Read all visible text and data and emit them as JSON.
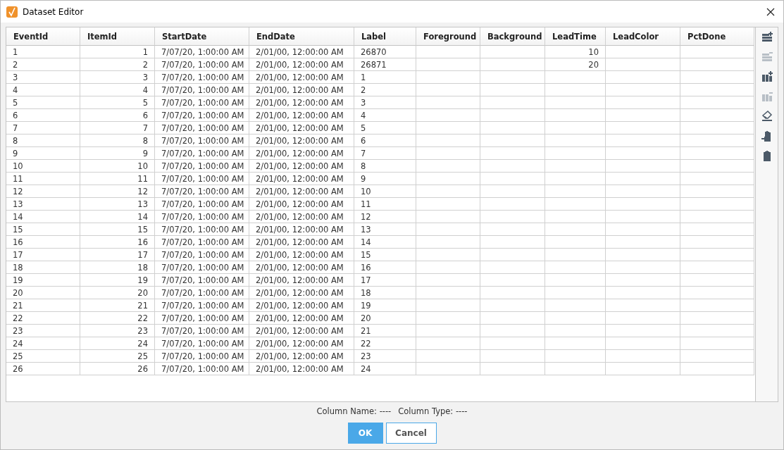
{
  "window": {
    "title": "Dataset Editor"
  },
  "table": {
    "columns": [
      {
        "label": "EventId",
        "numeric": false
      },
      {
        "label": "ItemId",
        "numeric": true
      },
      {
        "label": "StartDate",
        "numeric": false
      },
      {
        "label": "EndDate",
        "numeric": false
      },
      {
        "label": "Label",
        "numeric": false
      },
      {
        "label": "Foreground"
      },
      {
        "label": "Background"
      },
      {
        "label": "LeadTime",
        "numeric": true
      },
      {
        "label": "LeadColor"
      },
      {
        "label": "PctDone"
      }
    ],
    "rows": [
      [
        "1",
        "1",
        "7/07/20, 1:00:00 AM",
        "2/01/00, 12:00:00 AM",
        "26870",
        null,
        null,
        "10",
        null,
        null
      ],
      [
        "2",
        "2",
        "7/07/20, 1:00:00 AM",
        "2/01/00, 12:00:00 AM",
        "26871",
        null,
        null,
        "20",
        null,
        null
      ],
      [
        "3",
        "3",
        "7/07/20, 1:00:00 AM",
        "2/01/00, 12:00:00 AM",
        "1",
        null,
        null,
        null,
        null,
        null
      ],
      [
        "4",
        "4",
        "7/07/20, 1:00:00 AM",
        "2/01/00, 12:00:00 AM",
        "2",
        null,
        null,
        null,
        null,
        null
      ],
      [
        "5",
        "5",
        "7/07/20, 1:00:00 AM",
        "2/01/00, 12:00:00 AM",
        "3",
        null,
        null,
        null,
        null,
        null
      ],
      [
        "6",
        "6",
        "7/07/20, 1:00:00 AM",
        "2/01/00, 12:00:00 AM",
        "4",
        null,
        null,
        null,
        null,
        null
      ],
      [
        "7",
        "7",
        "7/07/20, 1:00:00 AM",
        "2/01/00, 12:00:00 AM",
        "5",
        null,
        null,
        null,
        null,
        null
      ],
      [
        "8",
        "8",
        "7/07/20, 1:00:00 AM",
        "2/01/00, 12:00:00 AM",
        "6",
        null,
        null,
        null,
        null,
        null
      ],
      [
        "9",
        "9",
        "7/07/20, 1:00:00 AM",
        "2/01/00, 12:00:00 AM",
        "7",
        null,
        null,
        null,
        null,
        null
      ],
      [
        "10",
        "10",
        "7/07/20, 1:00:00 AM",
        "2/01/00, 12:00:00 AM",
        "8",
        null,
        null,
        null,
        null,
        null
      ],
      [
        "11",
        "11",
        "7/07/20, 1:00:00 AM",
        "2/01/00, 12:00:00 AM",
        "9",
        null,
        null,
        null,
        null,
        null
      ],
      [
        "12",
        "12",
        "7/07/20, 1:00:00 AM",
        "2/01/00, 12:00:00 AM",
        "10",
        null,
        null,
        null,
        null,
        null
      ],
      [
        "13",
        "13",
        "7/07/20, 1:00:00 AM",
        "2/01/00, 12:00:00 AM",
        "11",
        null,
        null,
        null,
        null,
        null
      ],
      [
        "14",
        "14",
        "7/07/20, 1:00:00 AM",
        "2/01/00, 12:00:00 AM",
        "12",
        null,
        null,
        null,
        null,
        null
      ],
      [
        "15",
        "15",
        "7/07/20, 1:00:00 AM",
        "2/01/00, 12:00:00 AM",
        "13",
        null,
        null,
        null,
        null,
        null
      ],
      [
        "16",
        "16",
        "7/07/20, 1:00:00 AM",
        "2/01/00, 12:00:00 AM",
        "14",
        null,
        null,
        null,
        null,
        null
      ],
      [
        "17",
        "17",
        "7/07/20, 1:00:00 AM",
        "2/01/00, 12:00:00 AM",
        "15",
        null,
        null,
        null,
        null,
        null
      ],
      [
        "18",
        "18",
        "7/07/20, 1:00:00 AM",
        "2/01/00, 12:00:00 AM",
        "16",
        null,
        null,
        null,
        null,
        null
      ],
      [
        "19",
        "19",
        "7/07/20, 1:00:00 AM",
        "2/01/00, 12:00:00 AM",
        "17",
        null,
        null,
        null,
        null,
        null
      ],
      [
        "20",
        "20",
        "7/07/20, 1:00:00 AM",
        "2/01/00, 12:00:00 AM",
        "18",
        null,
        null,
        null,
        null,
        null
      ],
      [
        "21",
        "21",
        "7/07/20, 1:00:00 AM",
        "2/01/00, 12:00:00 AM",
        "19",
        null,
        null,
        null,
        null,
        null
      ],
      [
        "22",
        "22",
        "7/07/20, 1:00:00 AM",
        "2/01/00, 12:00:00 AM",
        "20",
        null,
        null,
        null,
        null,
        null
      ],
      [
        "23",
        "23",
        "7/07/20, 1:00:00 AM",
        "2/01/00, 12:00:00 AM",
        "21",
        null,
        null,
        null,
        null,
        null
      ],
      [
        "24",
        "24",
        "7/07/20, 1:00:00 AM",
        "2/01/00, 12:00:00 AM",
        "22",
        null,
        null,
        null,
        null,
        null
      ],
      [
        "25",
        "25",
        "7/07/20, 1:00:00 AM",
        "2/01/00, 12:00:00 AM",
        "23",
        null,
        null,
        null,
        null,
        null
      ],
      [
        "26",
        "26",
        "7/07/20, 1:00:00 AM",
        "2/01/00, 12:00:00 AM",
        "24",
        null,
        null,
        null,
        null,
        null
      ]
    ]
  },
  "toolbar": [
    {
      "kind": "add-row",
      "disabled": false
    },
    {
      "kind": "remove-row",
      "disabled": true
    },
    {
      "kind": "add-column",
      "disabled": false
    },
    {
      "kind": "remove-column",
      "disabled": true
    },
    {
      "kind": "eraser",
      "disabled": false
    },
    {
      "kind": "paste-into",
      "disabled": false
    },
    {
      "kind": "clipboard",
      "disabled": false
    }
  ],
  "status": {
    "column_name": "Column Name: ----",
    "column_type": "Column Type: ----"
  },
  "buttons": [
    {
      "label": "OK",
      "kind": "primary"
    },
    {
      "label": "Cancel",
      "kind": "secondary"
    }
  ]
}
